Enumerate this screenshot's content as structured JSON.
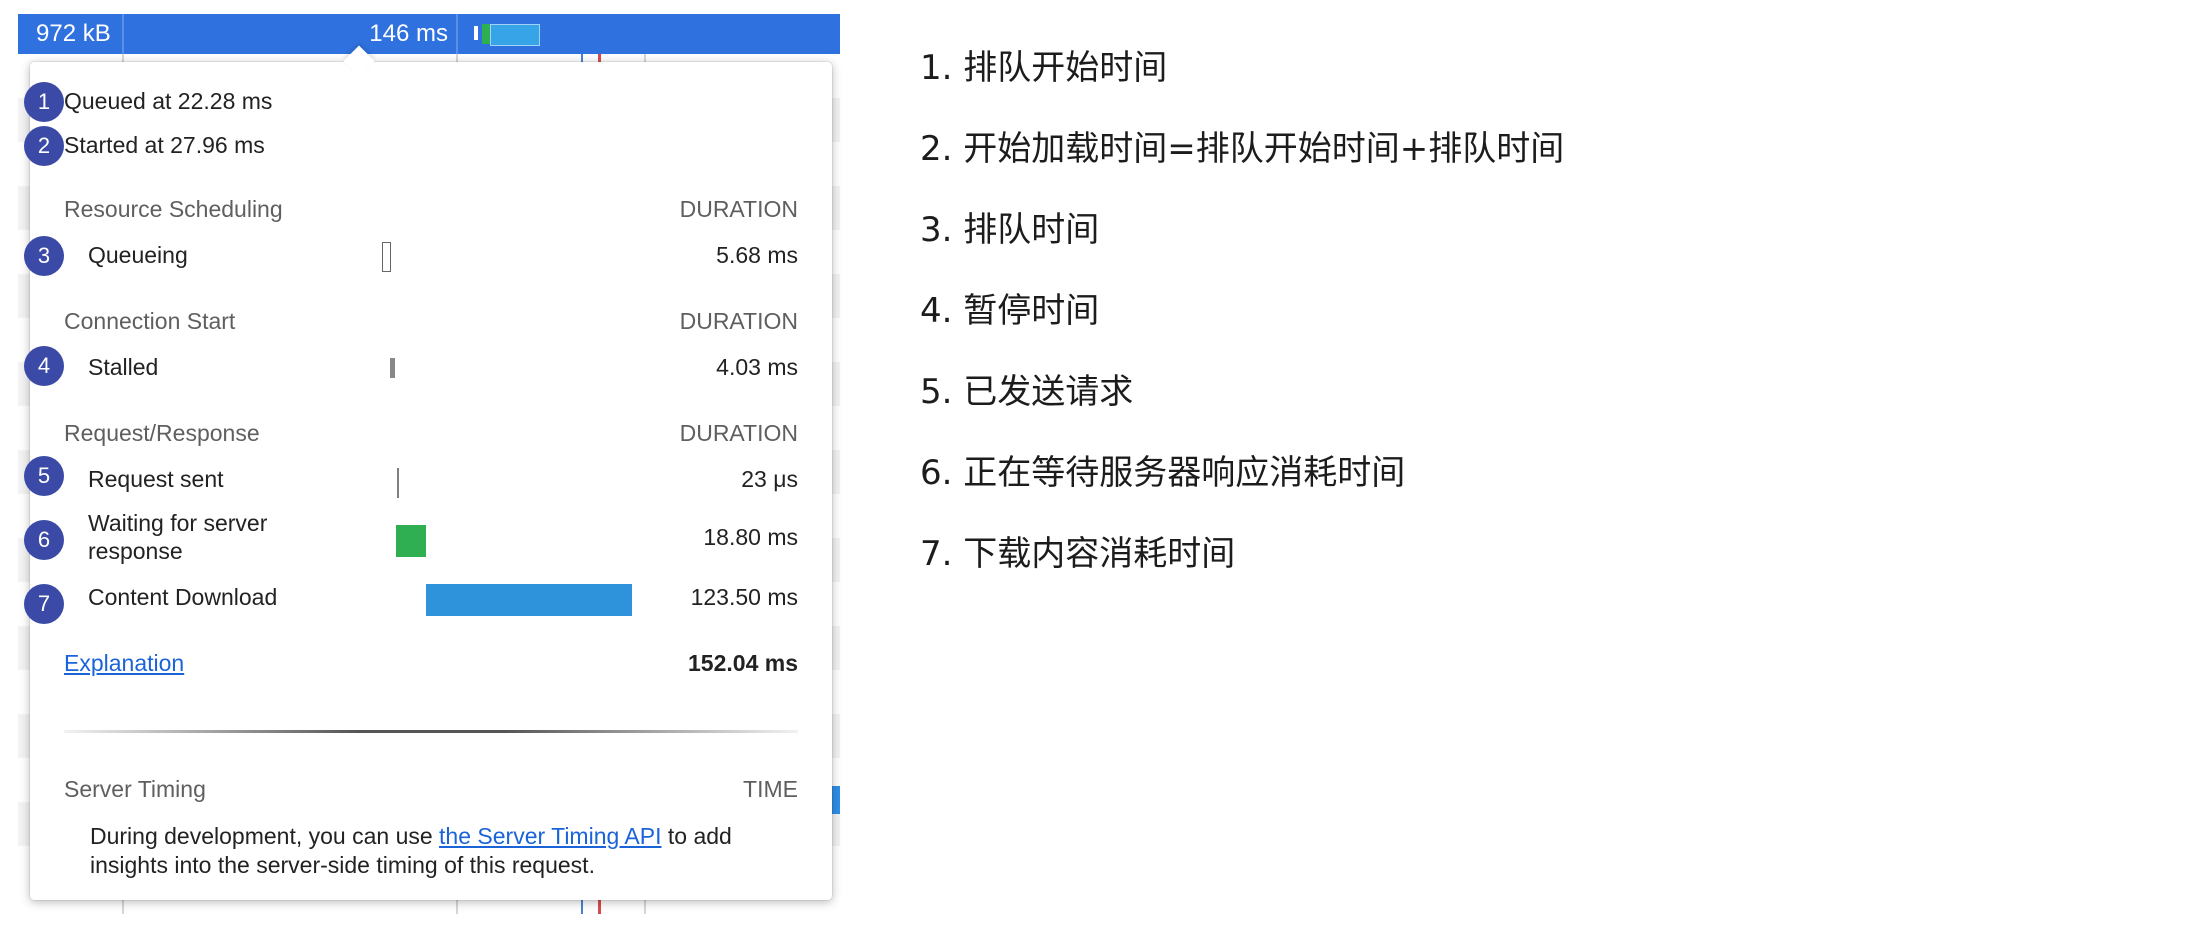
{
  "network_row": {
    "size": "972 kB",
    "time": "146 ms"
  },
  "popover": {
    "queued_at": "Queued at 22.28 ms",
    "started_at": "Started at 27.96 ms",
    "sections": [
      {
        "title": "Resource Scheduling",
        "column": "DURATION"
      },
      {
        "title": "Connection Start",
        "column": "DURATION"
      },
      {
        "title": "Request/Response",
        "column": "DURATION"
      }
    ],
    "phases": [
      {
        "label": "Queueing",
        "value": "5.68 ms"
      },
      {
        "label": "Stalled",
        "value": "4.03 ms"
      },
      {
        "label": "Request sent",
        "value": "23 μs"
      },
      {
        "label_line1": "Waiting for server",
        "label_line2": "response",
        "value": "18.80 ms"
      },
      {
        "label": "Content Download",
        "value": "123.50 ms"
      }
    ],
    "explanation_link": "Explanation",
    "total": "152.04 ms",
    "server_timing": {
      "title": "Server Timing",
      "column": "TIME",
      "text_before": "During development, you can use ",
      "link": "the Server Timing API",
      "text_after": " to add insights into the server-side timing of this request."
    },
    "badges": [
      "1",
      "2",
      "3",
      "4",
      "5",
      "6",
      "7"
    ]
  },
  "notes": [
    "1. 排队开始时间",
    "2. 开始加载时间=排队开始时间+排队时间",
    "3. 排队时间",
    "4. 暂停时间",
    "5. 已发送请求",
    "6. 正在等待服务器响应消耗时间",
    "7. 下载内容消耗时间"
  ],
  "colors": {
    "selected_row": "#2f72df",
    "badge": "#3b4aa6",
    "waiting_bar": "#2fae52",
    "download_bar": "#2f93db",
    "link": "#1a63d8"
  }
}
